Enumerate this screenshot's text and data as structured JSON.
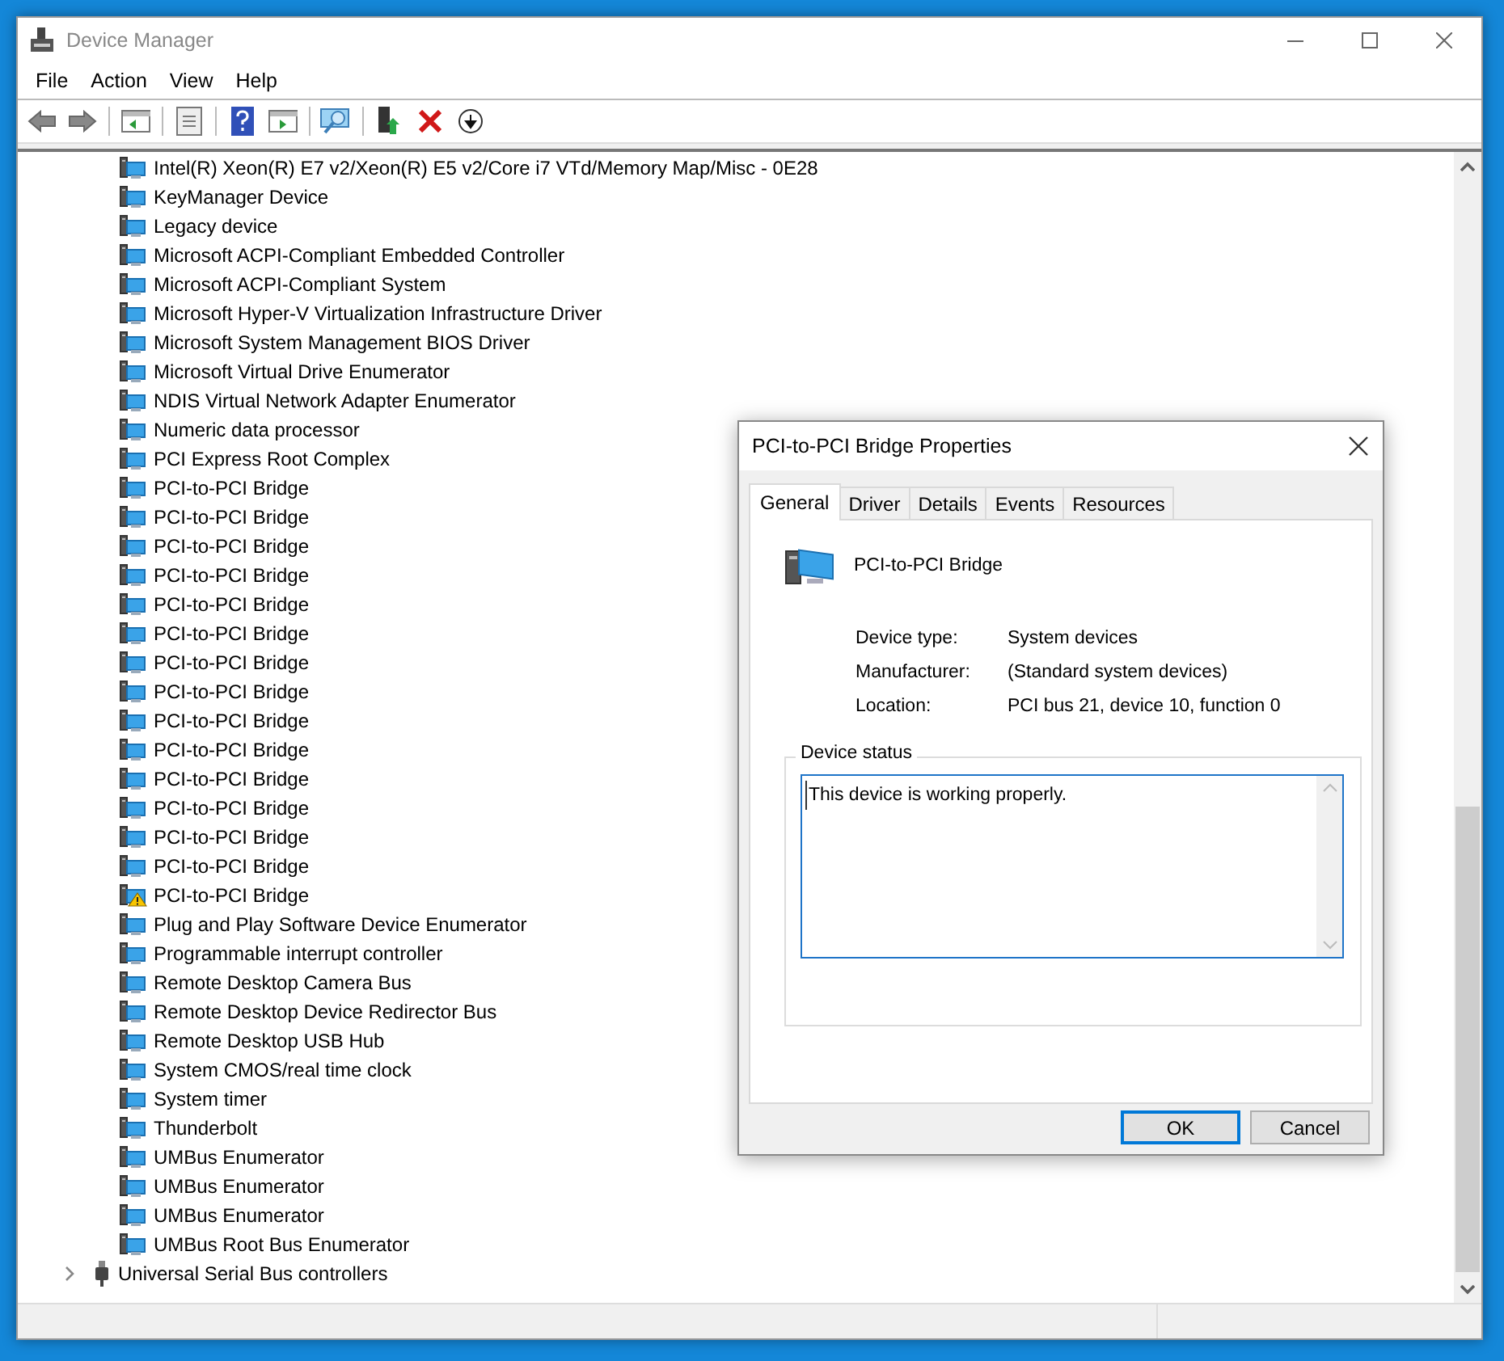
{
  "window": {
    "title": "Device Manager"
  },
  "menu": [
    "File",
    "Action",
    "View",
    "Help"
  ],
  "tree": [
    {
      "children": [
        {
          "label": "Intel(R) Xeon(R) E7 v2/Xeon(R) E5 v2/Core i7 VTd/Memory Map/Misc - 0E28",
          "warning": false
        },
        {
          "label": "KeyManager Device",
          "warning": false
        },
        {
          "label": "Legacy device",
          "warning": false
        },
        {
          "label": "Microsoft ACPI-Compliant Embedded Controller",
          "warning": false
        },
        {
          "label": "Microsoft ACPI-Compliant System",
          "warning": false
        },
        {
          "label": "Microsoft Hyper-V Virtualization Infrastructure Driver",
          "warning": false
        },
        {
          "label": "Microsoft System Management BIOS Driver",
          "warning": false
        },
        {
          "label": "Microsoft Virtual Drive Enumerator",
          "warning": false
        },
        {
          "label": "NDIS Virtual Network Adapter Enumerator",
          "warning": false
        },
        {
          "label": "Numeric data processor",
          "warning": false
        },
        {
          "label": "PCI Express Root Complex",
          "warning": false
        },
        {
          "label": "PCI-to-PCI Bridge",
          "warning": false
        },
        {
          "label": "PCI-to-PCI Bridge",
          "warning": false
        },
        {
          "label": "PCI-to-PCI Bridge",
          "warning": false
        },
        {
          "label": "PCI-to-PCI Bridge",
          "warning": false
        },
        {
          "label": "PCI-to-PCI Bridge",
          "warning": false
        },
        {
          "label": "PCI-to-PCI Bridge",
          "warning": false
        },
        {
          "label": "PCI-to-PCI Bridge",
          "warning": false
        },
        {
          "label": "PCI-to-PCI Bridge",
          "warning": false
        },
        {
          "label": "PCI-to-PCI Bridge",
          "warning": false
        },
        {
          "label": "PCI-to-PCI Bridge",
          "warning": false
        },
        {
          "label": "PCI-to-PCI Bridge",
          "warning": false
        },
        {
          "label": "PCI-to-PCI Bridge",
          "warning": false
        },
        {
          "label": "PCI-to-PCI Bridge",
          "warning": false
        },
        {
          "label": "PCI-to-PCI Bridge",
          "warning": false
        },
        {
          "label": "PCI-to-PCI Bridge",
          "warning": true
        },
        {
          "label": "Plug and Play Software Device Enumerator",
          "warning": false
        },
        {
          "label": "Programmable interrupt controller",
          "warning": false
        },
        {
          "label": "Remote Desktop Camera Bus",
          "warning": false
        },
        {
          "label": "Remote Desktop Device Redirector Bus",
          "warning": false
        },
        {
          "label": "Remote Desktop USB Hub",
          "warning": false
        },
        {
          "label": "System CMOS/real time clock",
          "warning": false
        },
        {
          "label": "System timer",
          "warning": false
        },
        {
          "label": "Thunderbolt",
          "warning": false
        },
        {
          "label": "UMBus Enumerator",
          "warning": false
        },
        {
          "label": "UMBus Enumerator",
          "warning": false
        },
        {
          "label": "UMBus Enumerator",
          "warning": false
        },
        {
          "label": "UMBus Root Bus Enumerator",
          "warning": false
        }
      ]
    },
    {
      "label": "Universal Serial Bus controllers",
      "expanded": false
    }
  ],
  "dialog": {
    "title": "PCI-to-PCI Bridge Properties",
    "tabs": [
      {
        "label": "General",
        "selected": true
      },
      {
        "label": "Driver",
        "selected": false
      },
      {
        "label": "Details",
        "selected": false
      },
      {
        "label": "Events",
        "selected": false
      },
      {
        "label": "Resources",
        "selected": false
      }
    ],
    "device_name": "PCI-to-PCI Bridge",
    "properties": [
      {
        "label": "Device type:",
        "value": "System devices"
      },
      {
        "label": "Manufacturer:",
        "value": "(Standard system devices)"
      },
      {
        "label": "Location:",
        "value": "PCI bus 21, device 10, function 0"
      }
    ],
    "status_group": {
      "title": "Device status",
      "value": "This device is working properly."
    },
    "buttons": [
      {
        "label": "OK",
        "default": true
      },
      {
        "label": "Cancel",
        "default": false
      }
    ]
  }
}
